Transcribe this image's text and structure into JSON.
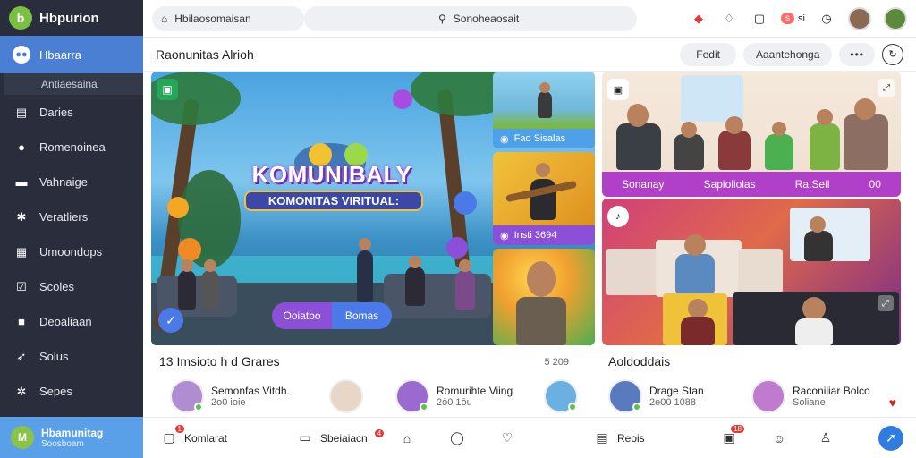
{
  "brand": {
    "name": "Hbpurion",
    "logo_letter": "b"
  },
  "sidebar": {
    "active": {
      "label": "Hbaarra",
      "icon": "people-icon"
    },
    "sub_label": "Antiaesaina",
    "items": [
      {
        "label": "Daries",
        "icon": "grid-icon"
      },
      {
        "label": "Romenoinea",
        "icon": "chat-icon"
      },
      {
        "label": "Vahnaige",
        "icon": "folder-icon"
      },
      {
        "label": "Veratliers",
        "icon": "group-icon"
      },
      {
        "label": "Umoondops",
        "icon": "chart-icon"
      },
      {
        "label": "Scoles",
        "icon": "check-icon"
      },
      {
        "label": "Deoaliaan",
        "icon": "lock-icon"
      },
      {
        "label": "Solus",
        "icon": "rocket-icon"
      },
      {
        "label": "Sepes",
        "icon": "gear-icon"
      }
    ],
    "footer": {
      "title": "Hbamunitag",
      "subtitle": "Soosboam"
    }
  },
  "topbar": {
    "search_left": "Hbilaosomaisan",
    "search_right": "Sonoheaosait",
    "badge_text": "s",
    "badge_text_2": "si"
  },
  "subbar": {
    "title": "Raonunitas Alrioh",
    "btn1": "Fedit",
    "btn2": "Aaantehonga",
    "btn3": "•••"
  },
  "hero": {
    "title": "KOMUNIBALY",
    "subtitle": "KOMONITAS VIRITUAL:",
    "btn_a": "Ooiatbo",
    "btn_b": "Bomas"
  },
  "tiles": [
    {
      "caption": "Fao Sisalas"
    },
    {
      "caption": "Insti 3694"
    }
  ],
  "right_panel": {
    "strip_labels": [
      "Sonanay",
      "Sapioliolas",
      "Ra.Seil",
      "00"
    ]
  },
  "cards": {
    "left": {
      "title": "13 Imsioto h d Grares",
      "meta": "5 209",
      "users": [
        {
          "name": "Semonfas Vitdh.",
          "meta": "2o0 ioie"
        },
        {
          "name": "Romurihte Viing",
          "meta": "2ō0 1ōu"
        }
      ]
    },
    "right": {
      "title": "Aoldoddais",
      "users": [
        {
          "name": "Drage Stan",
          "meta": "2e00 1088"
        },
        {
          "name": "Raconiliar Bolco",
          "meta": "Soliane"
        }
      ]
    }
  },
  "bottombar": {
    "item1": "Komlarat",
    "item1_badge": "1",
    "item2": "Sbeiaiacn",
    "item2_badge": "4",
    "item3": "Reois",
    "item4_badge": "18"
  }
}
